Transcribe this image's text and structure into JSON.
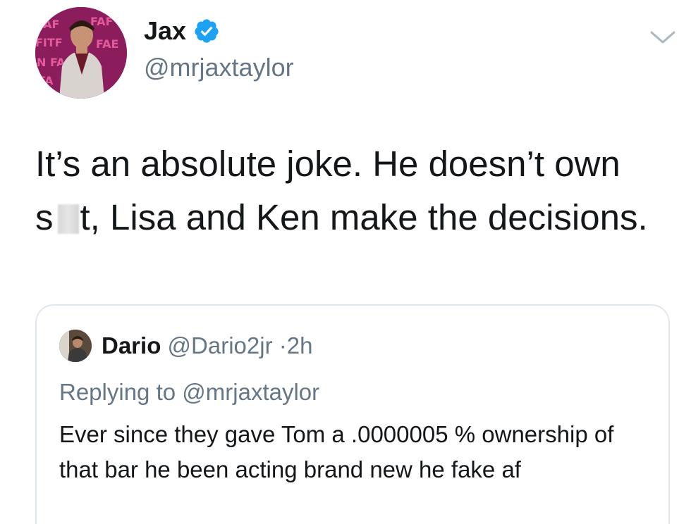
{
  "author": {
    "display_name": "Jax",
    "handle": "@mrjaxtaylor",
    "verified": true,
    "avatar_icon": "profile-photo"
  },
  "tweet": {
    "text_part1": "It’s an absolute joke. He doesn’t own",
    "text_part2_pre": "s",
    "text_part2_post": "t, Lisa and Ken make the decisions."
  },
  "quoted_tweet": {
    "display_name": "Dario",
    "handle": "@Dario2jr",
    "separator": "·",
    "time": "2h",
    "replying_to_prefix": "Replying to",
    "replying_to_handle": "@mrjaxtaylor",
    "text": "Ever since they gave Tom a .0000005 % ownership of that bar he been acting brand new he fake af"
  },
  "colors": {
    "text": "#14171a",
    "secondary": "#657786",
    "verified_blue": "#1da1f2",
    "border": "#e1e8ed"
  },
  "icons": {
    "verified": "verified-badge-icon",
    "menu": "chevron-down-icon"
  }
}
